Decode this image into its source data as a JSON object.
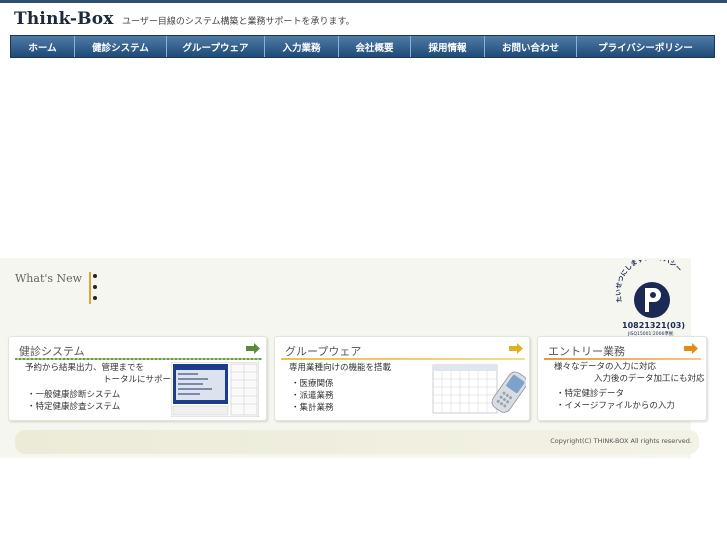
{
  "header": {
    "logo": "Think-Box",
    "tagline": "ユーザー目線のシステム構築と業務サポートを承ります。"
  },
  "nav": {
    "items": [
      {
        "label": "ホーム"
      },
      {
        "label": "健診システム"
      },
      {
        "label": "グループウェア"
      },
      {
        "label": "入力業務"
      },
      {
        "label": "会社概要"
      },
      {
        "label": "採用情報"
      },
      {
        "label": "お問い合わせ"
      },
      {
        "label": "プライバシーポリシー"
      }
    ]
  },
  "news": {
    "title": "What's New",
    "items": [
      "",
      "",
      ""
    ]
  },
  "privacy_mark": {
    "arc_text": "たいせつにしますプライバシー",
    "number": "10821321(03)",
    "sub": "JISQ15001:2006準拠"
  },
  "cards": {
    "kenshin": {
      "title": "健診システム",
      "line1": "予約から結果出力、管理までを",
      "line2": "トータルにサポート",
      "items": [
        "一般健康診断システム",
        "特定健康診査システム"
      ],
      "accent": "#5a8a3a"
    },
    "groupware": {
      "title": "グループウェア",
      "line1": "専用業種向けの機能を搭載",
      "items": [
        "医療関係",
        "派遣業務",
        "集計業務"
      ],
      "accent": "#e0b020"
    },
    "entry": {
      "title": "エントリー業務",
      "line1": "様々なデータの入力に対応",
      "line2": "入力後のデータ加工にも対応",
      "items": [
        "特定健診データ",
        "イメージファイルからの入力"
      ],
      "accent": "#e08a20"
    }
  },
  "footer": {
    "copyright": "Copyright(C) THINK-BOX All rights reserved."
  }
}
